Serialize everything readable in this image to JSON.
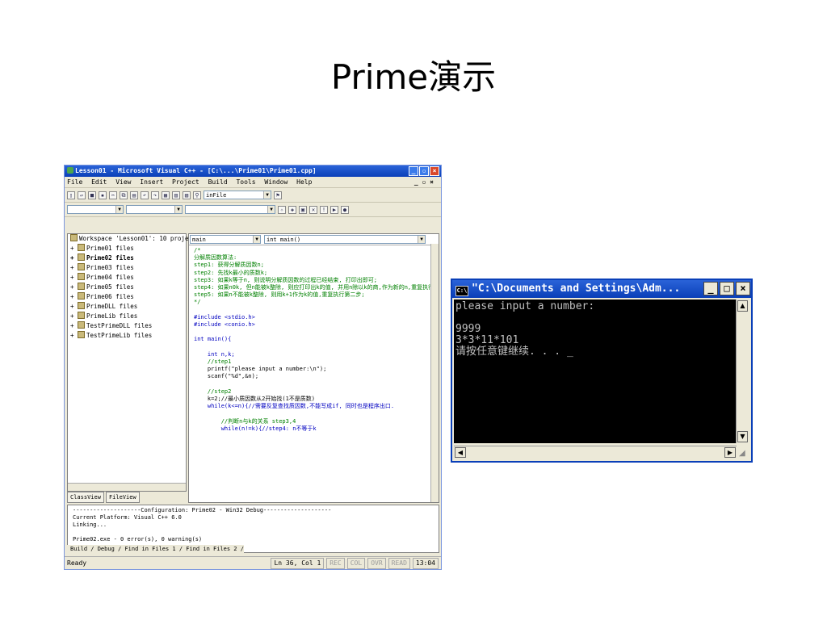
{
  "slide": {
    "title": "Prime演示"
  },
  "vc": {
    "title": "Lesson01 - Microsoft Visual C++ - [C:\\...\\Prime01\\Prime01.cpp]",
    "menu": [
      "File",
      "Edit",
      "View",
      "Insert",
      "Project",
      "Build",
      "Tools",
      "Window",
      "Help"
    ],
    "toolbar_combo": "inFile",
    "editor_combo_left": "main",
    "editor_combo_right": "int main()",
    "workspace_items": [
      {
        "label": "Workspace 'Lesson01': 10 project(s)",
        "bold": false
      },
      {
        "label": "Prime01 files",
        "bold": false
      },
      {
        "label": "Prime02 files",
        "bold": true
      },
      {
        "label": "Prime03 files",
        "bold": false
      },
      {
        "label": "Prime04 files",
        "bold": false
      },
      {
        "label": "Prime05 files",
        "bold": false
      },
      {
        "label": "Prime06 files",
        "bold": false
      },
      {
        "label": "PrimeDLL files",
        "bold": false
      },
      {
        "label": "PrimeLib files",
        "bold": false
      },
      {
        "label": "TestPrimeDLL files",
        "bold": false
      },
      {
        "label": "TestPrimeLib files",
        "bold": false
      }
    ],
    "left_tabs": [
      "ClassView",
      "FileView"
    ],
    "code_comment": [
      "/*",
      "分解质因数算法:",
      "step1: 获得分解质因数n;",
      "step2: 先找k最小的质数k;",
      "step3: 如果k等于n, 则说明分解质因数的过程已经结束, 打印出即可;",
      "step4: 如果n0k, 但n能被k整除, 则应打印出k的值, 并用n除以k的商,作为新的n,重复执行",
      "step5: 如果n不能被k整除, 则用k+1作为k的值,重复执行第二步;",
      "*/"
    ],
    "code_include": [
      "#include <stdio.h>",
      "#include <conio.h>"
    ],
    "code_main": "int main(){",
    "code_body": [
      "int n,k;",
      "//step1",
      "printf(\"please input a number:\\n\");",
      "scanf(\"%d\",&n);",
      "",
      "//step2",
      "k=2;//最小质因数从2开始找(1不是质数)",
      "while(k<=n){//需要反复查找质因数,不能写成if, 同时也是程序出口.",
      "",
      "    //判断n与k的关系 step3,4",
      "    while(n!=k){//step4: n不等于k"
    ],
    "output_lines": [
      "--------------------Configuration: Prime02 - Win32 Debug--------------------",
      "Current Platform: Visual C++ 6.0",
      "Linking...",
      "",
      "Prime02.exe - 0 error(s), 0 warning(s)"
    ],
    "output_tabs": "Build / Debug / Find in Files 1 / Find in Files 2 /",
    "status": {
      "ready": "Ready",
      "position": "Ln 36, Col 1",
      "flags": [
        "REC",
        "COL",
        "OVR",
        "READ"
      ],
      "time": "13:04"
    }
  },
  "console": {
    "title": "\"C:\\Documents and Settings\\Adm...",
    "lines": [
      "please input a number:",
      "",
      "9999",
      "3*3*11*101",
      "请按任意键继续. . . _"
    ]
  }
}
